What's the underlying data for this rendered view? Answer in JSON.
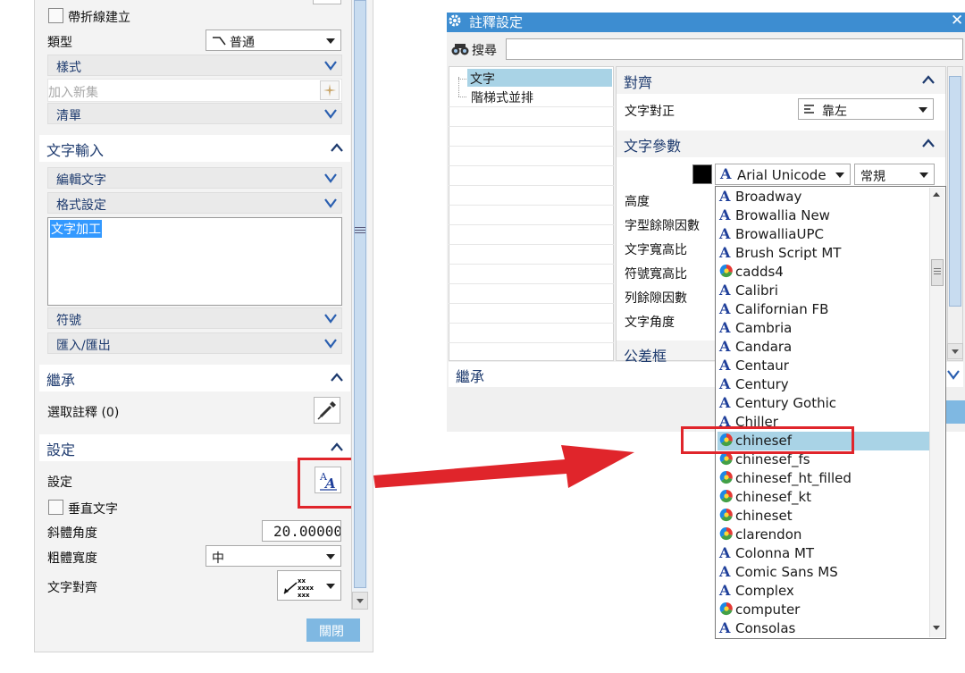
{
  "left_panel": {
    "polyline_checkbox_label": "帶折線建立",
    "type_label": "類型",
    "type_value": "普通",
    "style_label": "樣式",
    "add_set_label": "加入新集",
    "list_label": "清單",
    "text_input_title": "文字輸入",
    "edit_text_label": "編輯文字",
    "format_label": "格式設定",
    "text_area_value": "文字加工",
    "symbol_label": "符號",
    "import_export_label": "匯入/匯出",
    "inherit_title": "繼承",
    "select_note_label": "選取註釋 (0)",
    "settings_title": "設定",
    "settings_label": "設定",
    "vertical_text_label": "垂直文字",
    "italic_angle_label": "斜體角度",
    "italic_angle_value": "20.00000",
    "bold_width_label": "粗體寬度",
    "bold_width_value": "中",
    "text_align_label": "文字對齊",
    "close_button": "關閉"
  },
  "dialog": {
    "title": "註釋設定",
    "search_label": "搜尋",
    "search_value": "",
    "tree_items": [
      "文字",
      "階梯式並排"
    ],
    "align_section": "對齊",
    "text_justify_label": "文字對正",
    "text_justify_value": "靠左",
    "text_params_section": "文字參數",
    "font_value": "Arial Unicode M",
    "font_style_value": "常規",
    "height_label": "高度",
    "char_gap_label": "字型餘隙因數",
    "text_aspect_label": "文字寬高比",
    "symbol_aspect_label": "符號寬高比",
    "line_gap_label": "列餘隙因數",
    "text_angle_label": "文字角度",
    "tolerance_section": "公差框",
    "inherit_section": "繼承",
    "text_color": "#000000"
  },
  "font_list": {
    "selected": "chinesef",
    "items": [
      {
        "name": "Broadway",
        "icon": "truetype-icon"
      },
      {
        "name": "Browallia New",
        "icon": "truetype-icon"
      },
      {
        "name": "BrowalliaUPC",
        "icon": "truetype-icon"
      },
      {
        "name": "Brush Script MT",
        "icon": "truetype-icon"
      },
      {
        "name": "cadds4",
        "icon": "nx-font-icon"
      },
      {
        "name": "Calibri",
        "icon": "truetype-icon"
      },
      {
        "name": "Californian FB",
        "icon": "truetype-icon"
      },
      {
        "name": "Cambria",
        "icon": "truetype-icon"
      },
      {
        "name": "Candara",
        "icon": "truetype-icon"
      },
      {
        "name": "Centaur",
        "icon": "truetype-icon"
      },
      {
        "name": "Century",
        "icon": "truetype-icon"
      },
      {
        "name": "Century Gothic",
        "icon": "truetype-icon"
      },
      {
        "name": "Chiller",
        "icon": "truetype-icon"
      },
      {
        "name": "chinesef",
        "icon": "nx-font-icon"
      },
      {
        "name": "chinesef_fs",
        "icon": "nx-font-icon"
      },
      {
        "name": "chinesef_ht_filled",
        "icon": "nx-font-icon"
      },
      {
        "name": "chinesef_kt",
        "icon": "nx-font-icon"
      },
      {
        "name": "chineset",
        "icon": "nx-font-icon"
      },
      {
        "name": "clarendon",
        "icon": "nx-font-icon"
      },
      {
        "name": "Colonna MT",
        "icon": "truetype-icon"
      },
      {
        "name": "Comic Sans MS",
        "icon": "truetype-icon"
      },
      {
        "name": "Complex",
        "icon": "truetype-icon"
      },
      {
        "name": "computer",
        "icon": "nx-font-icon"
      },
      {
        "name": "Consolas",
        "icon": "truetype-icon"
      }
    ]
  },
  "colors": {
    "accent_blue": "#3d8dd1",
    "section_title": "#1d3a6e",
    "highlight_red": "#e0252b",
    "selection_blue": "#a9d3e6"
  }
}
